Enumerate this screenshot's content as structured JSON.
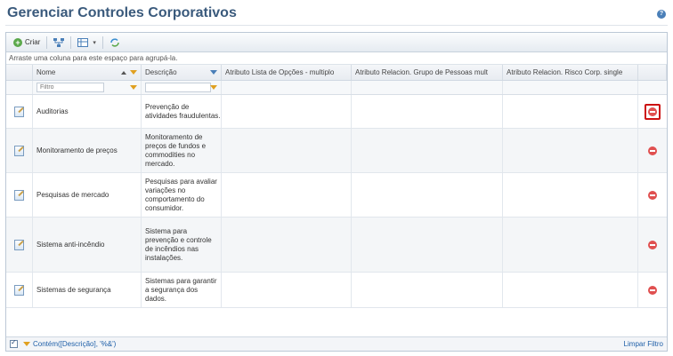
{
  "page": {
    "title": "Gerenciar Controles Corporativos",
    "help": "?"
  },
  "toolbar": {
    "create_label": "Criar"
  },
  "group_hint": "Arraste uma coluna para este espaço para agrupá-la.",
  "columns": {
    "name": "Nome",
    "description": "Descrição",
    "attr_list": "Atributo Lista de Opções - multiplo",
    "attr_group": "Atributo Relacion. Grupo de Pessoas mult",
    "attr_risk": "Atributo Relacion. Risco Corp. single"
  },
  "filters": {
    "name_placeholder": "Filtro",
    "description_value": ""
  },
  "rows": [
    {
      "name": "Auditorias",
      "description": "Prevenção de atividades fraudulentas."
    },
    {
      "name": "Monitoramento de preços",
      "description": "Monitoramento de preços de fundos e commodities no mercado."
    },
    {
      "name": "Pesquisas de mercado",
      "description": "Pesquisas para avaliar variações no comportamento do consumidor."
    },
    {
      "name": "Sistema anti-incêndio",
      "description": "Sistema para prevenção e controle de incêndios nas instalações."
    },
    {
      "name": "Sistemas de segurança",
      "description": "Sistemas para garantir a segurança dos dados."
    }
  ],
  "footer": {
    "filter_expression": "Contém([Descrição], '%&')",
    "clear_filter": "Limpar Filtro"
  },
  "colors": {
    "title": "#3a5a7c",
    "delete": "#e05050",
    "highlight": "#cc1111",
    "link": "#1e5fa8"
  }
}
